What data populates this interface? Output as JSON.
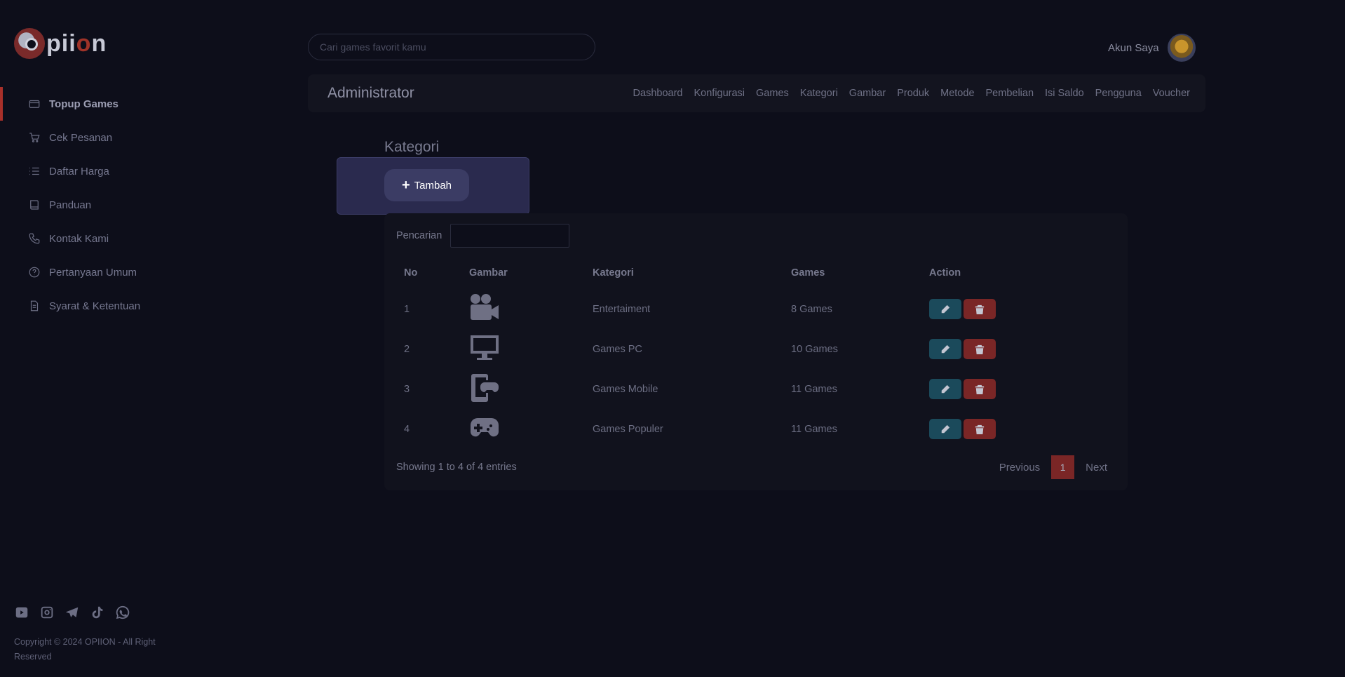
{
  "brand": {
    "logo_text_a": "pii",
    "logo_text_o": "o",
    "logo_text_b": "n"
  },
  "sidebar": {
    "items": [
      {
        "label": "Topup Games",
        "icon": "card-icon",
        "active": true
      },
      {
        "label": "Cek Pesanan",
        "icon": "cart-icon"
      },
      {
        "label": "Daftar Harga",
        "icon": "list-icon"
      },
      {
        "label": "Panduan",
        "icon": "book-icon"
      },
      {
        "label": "Kontak Kami",
        "icon": "phone-icon"
      },
      {
        "label": "Pertanyaan Umum",
        "icon": "help-circle-icon"
      },
      {
        "label": "Syarat & Ketentuan",
        "icon": "document-icon"
      }
    ],
    "socials": [
      "youtube-icon",
      "instagram-icon",
      "telegram-icon",
      "tiktok-icon",
      "whatsapp-icon"
    ],
    "copyright": "Copyright © 2024 OPIION - All Right Reserved"
  },
  "topbar": {
    "search_placeholder": "Cari games favorit kamu",
    "account_label": "Akun Saya"
  },
  "admin": {
    "title": "Administrator",
    "menu": [
      "Dashboard",
      "Konfigurasi",
      "Games",
      "Kategori",
      "Gambar",
      "Produk",
      "Metode",
      "Pembelian",
      "Isi Saldo",
      "Pengguna",
      "Voucher"
    ]
  },
  "page": {
    "title": "Kategori",
    "add_label": "Tambah",
    "search_label": "Pencarian",
    "columns": [
      "No",
      "Gambar",
      "Kategori",
      "Games",
      "Action"
    ],
    "rows": [
      {
        "no": "1",
        "icon": "video-camera-icon",
        "kategori": "Entertaiment",
        "games": "8 Games"
      },
      {
        "no": "2",
        "icon": "monitor-icon",
        "kategori": "Games PC",
        "games": "10 Games"
      },
      {
        "no": "3",
        "icon": "mobile-gamepad-icon",
        "kategori": "Games Mobile",
        "games": "11 Games"
      },
      {
        "no": "4",
        "icon": "gamepad-icon",
        "kategori": "Games Populer",
        "games": "11 Games"
      }
    ],
    "info": "Showing 1 to 4 of 4 entries",
    "pagination": {
      "previous": "Previous",
      "current": "1",
      "next": "Next"
    }
  },
  "colors": {
    "accent": "#a8302a",
    "edit": "#1b4a5b",
    "delete": "#7a2626",
    "background": "#0d0e1a"
  }
}
